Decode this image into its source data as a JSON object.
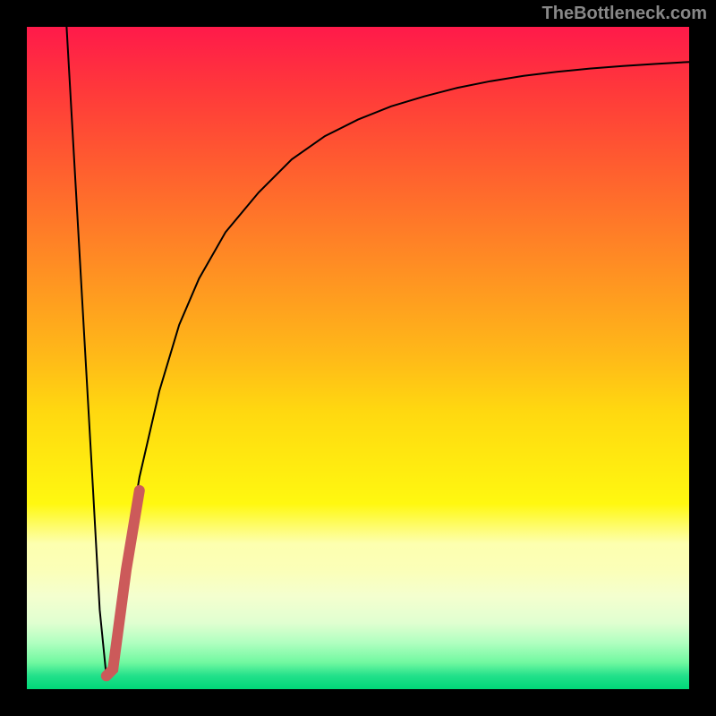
{
  "watermark": "TheBottleneck.com",
  "chart_data": {
    "type": "line",
    "title": "",
    "xlabel": "",
    "ylabel": "",
    "xlim": [
      0,
      100
    ],
    "ylim": [
      0,
      100
    ],
    "grid": false,
    "series": [
      {
        "name": "bottleneck-curve",
        "color": "#000000",
        "width": 2,
        "x": [
          6,
          8,
          10,
          11,
          12,
          13,
          14,
          15,
          17,
          20,
          23,
          26,
          30,
          35,
          40,
          45,
          50,
          55,
          60,
          65,
          70,
          75,
          80,
          85,
          90,
          95,
          100
        ],
        "y": [
          100,
          65,
          30,
          12,
          2,
          5,
          12,
          20,
          32,
          45,
          55,
          62,
          69,
          75,
          80,
          83.5,
          86,
          88,
          89.5,
          90.8,
          91.8,
          92.6,
          93.2,
          93.7,
          94.1,
          94.4,
          94.7
        ]
      },
      {
        "name": "highlight-segment",
        "color": "#cc5a5a",
        "width": 12,
        "linecap": "round",
        "x": [
          12,
          13,
          15,
          17
        ],
        "y": [
          2,
          3,
          18,
          30
        ]
      }
    ],
    "gradient_stops": [
      {
        "pos": 0,
        "color": "#ff1a4a"
      },
      {
        "pos": 50,
        "color": "#ffd810"
      },
      {
        "pos": 100,
        "color": "#00d878"
      }
    ]
  }
}
